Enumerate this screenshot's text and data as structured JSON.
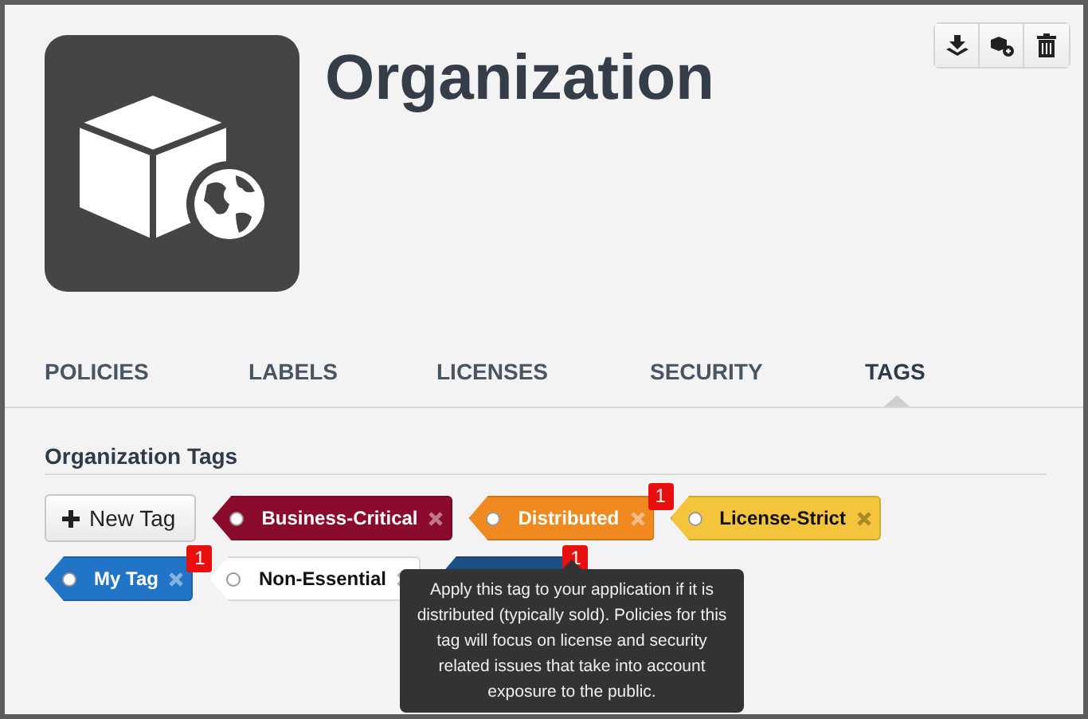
{
  "header": {
    "title": "Organization"
  },
  "tabs": [
    {
      "label": "POLICIES",
      "selected": false
    },
    {
      "label": "LABELS",
      "selected": false
    },
    {
      "label": "LICENSES",
      "selected": false
    },
    {
      "label": "SECURITY",
      "selected": false
    },
    {
      "label": "TAGS",
      "selected": true
    }
  ],
  "section": {
    "heading": "Organization Tags",
    "new_button": "New Tag"
  },
  "tags": [
    {
      "label": "Business-Critical",
      "color": "#8b0b2c"
    },
    {
      "label": "Distributed",
      "color": "#f0891f",
      "badge": "1"
    },
    {
      "label": "License-Strict",
      "color": "#f4c53c"
    },
    {
      "label": "My Tag",
      "color": "#2274c7",
      "badge": "1"
    },
    {
      "label": "Non-Essential",
      "color": "#ffffff"
    },
    {
      "color": "#1c4f86",
      "badge": "1"
    }
  ],
  "tooltip": {
    "text": "Apply this tag to your application if it is distributed (typically sold). Policies for this tag will focus on license and security related issues that take into account exposure to the public."
  }
}
